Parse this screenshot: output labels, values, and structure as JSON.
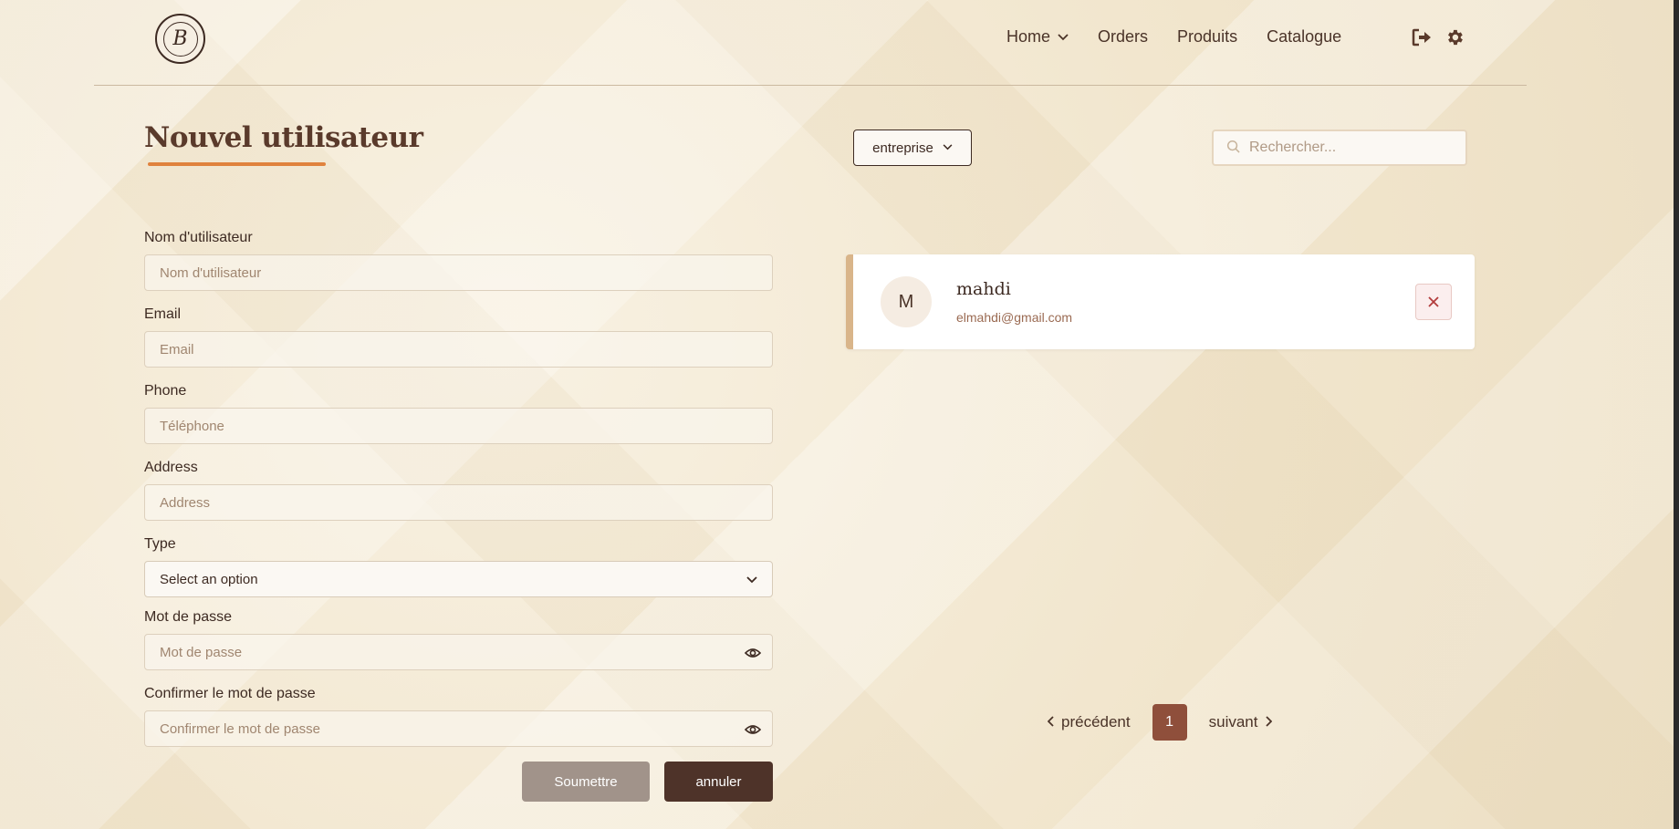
{
  "header": {
    "logo_text": "B",
    "nav": [
      {
        "label": "Home",
        "has_dropdown": true
      },
      {
        "label": "Orders"
      },
      {
        "label": "Produits"
      },
      {
        "label": "Catalogue"
      }
    ],
    "icons": [
      "logout-icon",
      "gear-icon"
    ]
  },
  "form": {
    "title": "Nouvel utilisateur",
    "username": {
      "label": "Nom d'utilisateur",
      "placeholder": "Nom d'utilisateur",
      "value": ""
    },
    "email": {
      "label": "Email",
      "placeholder": "Email",
      "value": ""
    },
    "phone": {
      "label": "Phone",
      "placeholder": "Téléphone",
      "value": ""
    },
    "address": {
      "label": "Address",
      "placeholder": "Address",
      "value": ""
    },
    "type": {
      "label": "Type",
      "selected": "Select an option"
    },
    "password": {
      "label": "Mot de passe",
      "placeholder": "Mot de passe",
      "value": ""
    },
    "confirm_password": {
      "label": "Confirmer le mot de passe",
      "placeholder": "Confirmer le mot de passe",
      "value": ""
    },
    "submit_label": "Soumettre",
    "cancel_label": "annuler"
  },
  "list": {
    "filter": {
      "selected": "entreprise"
    },
    "search": {
      "placeholder": "Rechercher...",
      "value": ""
    },
    "users": [
      {
        "initial": "M",
        "name": "mahdi",
        "email": "elmahdi@gmail.com"
      }
    ],
    "pagination": {
      "prev_label": "précédent",
      "current_page": "1",
      "next_label": "suivant"
    }
  },
  "colors": {
    "accent": "#e0823d",
    "primary_dark": "#4e3329",
    "page_active": "#8f4f3b",
    "card_border": "#d9b58a",
    "submit_disabled": "#a1938a"
  }
}
